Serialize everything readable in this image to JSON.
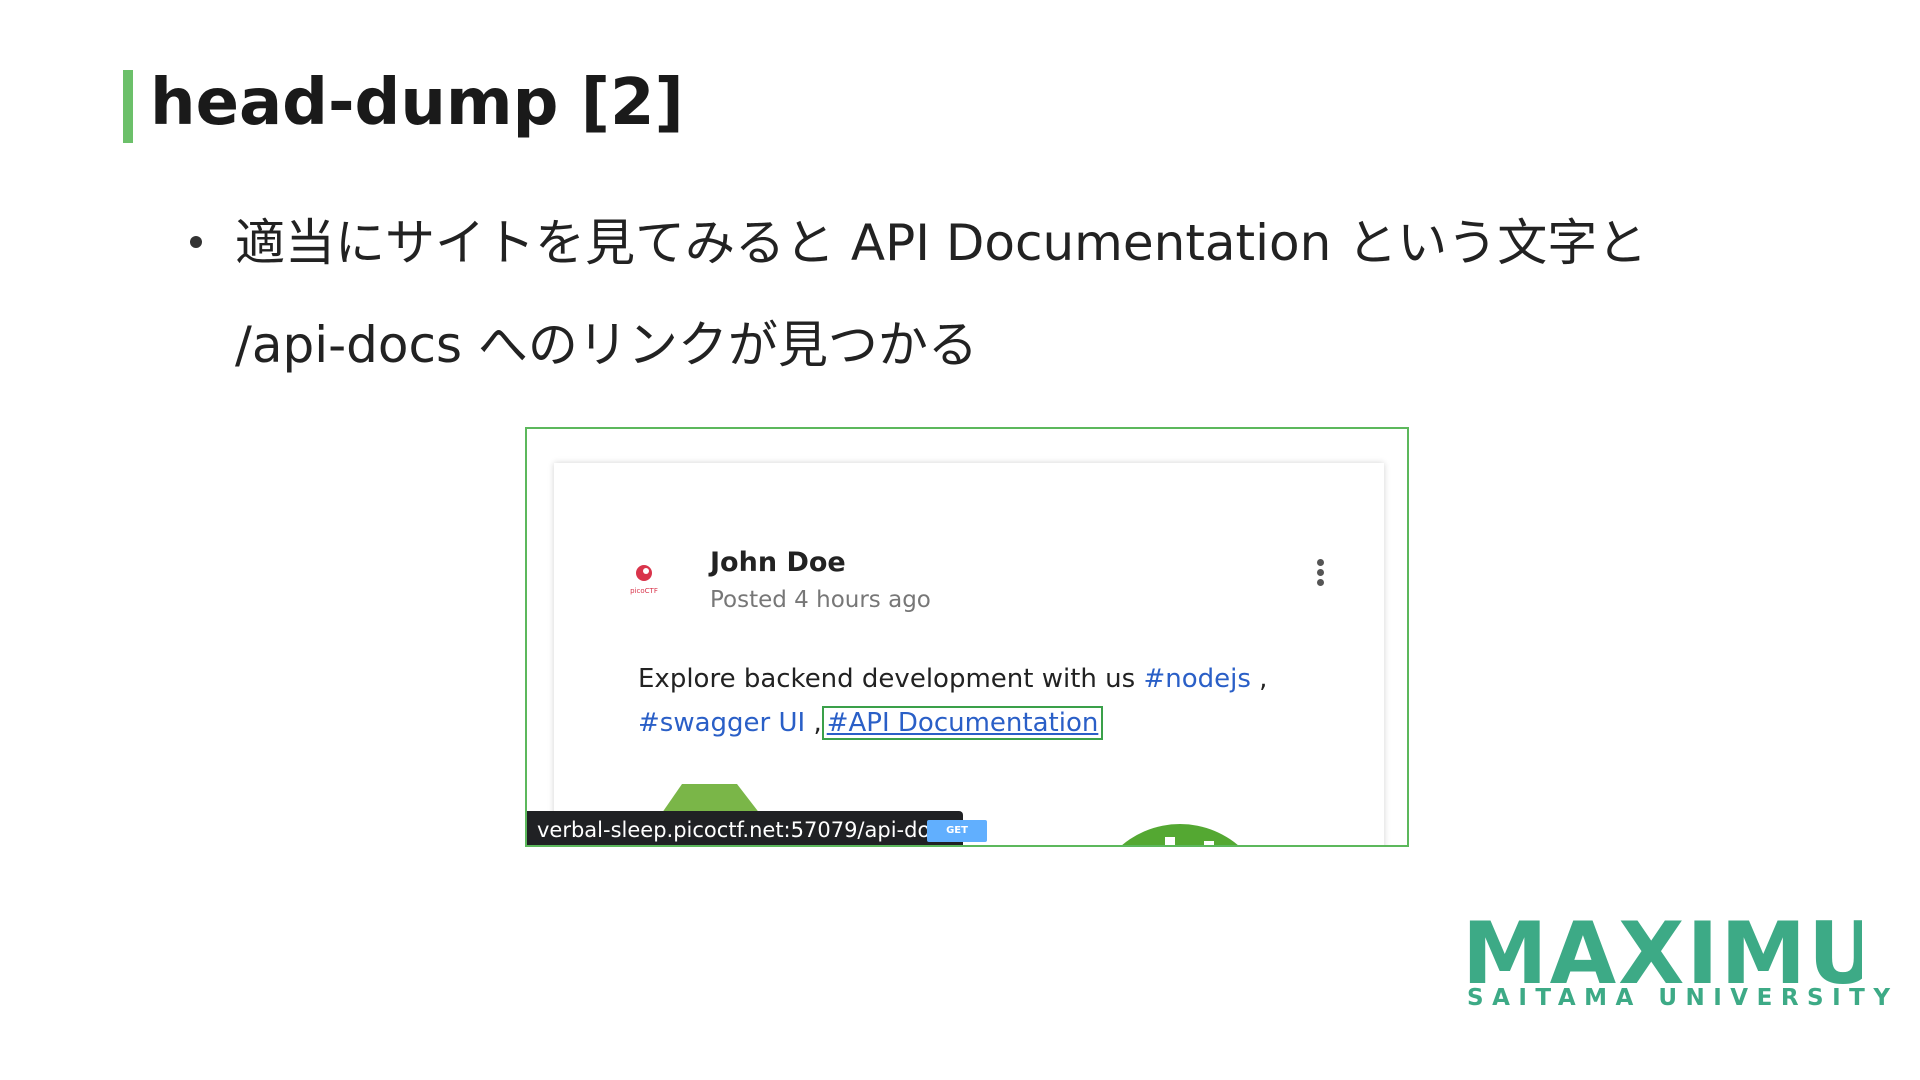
{
  "slide": {
    "title": "head-dump [2]",
    "bullet_line1": "適当にサイトを見てみると API Documentation という文字と",
    "bullet_line2": "/api-docs へのリンクが見つかる"
  },
  "screenshot": {
    "author": "John Doe",
    "posted": "Posted 4 hours ago",
    "post_text_prefix": "Explore backend development with us ",
    "tag_nodejs": "#nodejs",
    "sep1": " ,",
    "tag_swagger": "#swagger UI",
    "sep2": " ,",
    "tag_api_docs": "#API Documentation",
    "status_url": "verbal-sleep.picoctf.net:57079/api-docs",
    "get_badge": "GET",
    "avatar_label": "picoCTF"
  },
  "logo": {
    "main": "MAXIMUM",
    "sub": "SAITAMA UNIVERSITY",
    "color": "#3daa86"
  },
  "colors": {
    "accent_green": "#6cc06a",
    "link_blue": "#2a5fc7",
    "swagger_green": "#7ab648",
    "get_blue": "#61affe"
  }
}
